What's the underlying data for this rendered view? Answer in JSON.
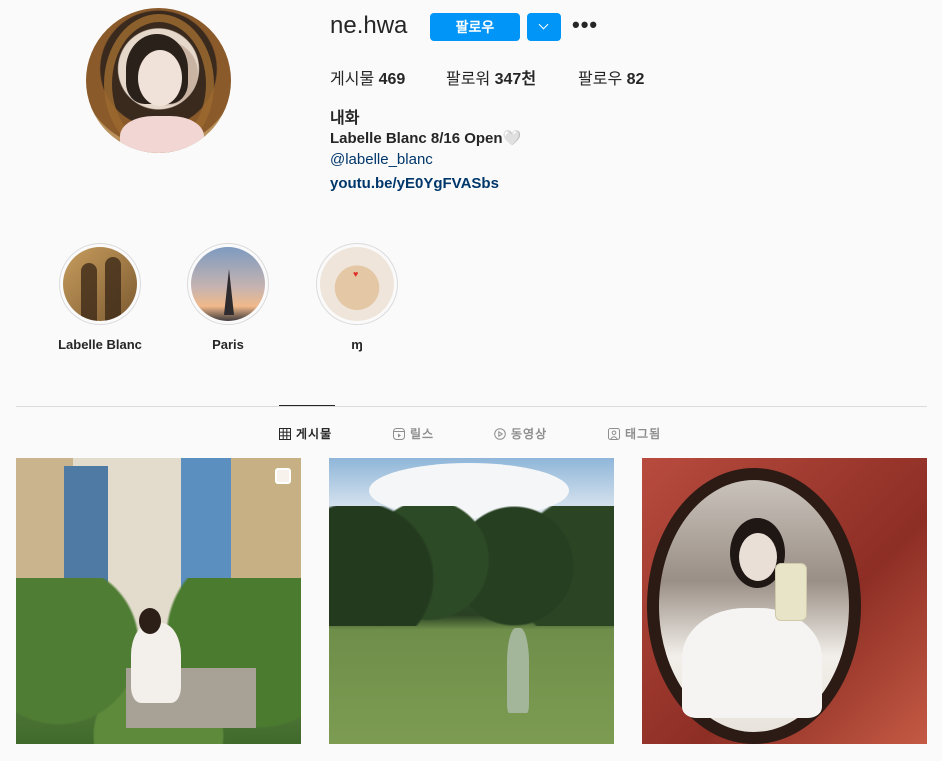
{
  "profile": {
    "username": "ne.hwa",
    "follow_label": "팔로우",
    "more_label": "•••",
    "stats": {
      "posts_label": "게시물",
      "posts_value": "469",
      "followers_label": "팔로워",
      "followers_value": "347천",
      "following_label": "팔로우",
      "following_value": "82"
    },
    "full_name": "내화",
    "bio_line": "Labelle Blanc 8/16 Open🤍",
    "mention": "@labelle_blanc",
    "link": "youtu.be/yE0YgFVASbs"
  },
  "highlights": [
    {
      "label": "Labelle Blanc"
    },
    {
      "label": "Paris"
    },
    {
      "label": "ɱ"
    }
  ],
  "tabs": [
    {
      "label": "게시물",
      "icon": "grid-icon",
      "active": true
    },
    {
      "label": "릴스",
      "icon": "reels-icon",
      "active": false
    },
    {
      "label": "동영상",
      "icon": "video-icon",
      "active": false
    },
    {
      "label": "태그됨",
      "icon": "tagged-icon",
      "active": false
    }
  ],
  "colors": {
    "accent": "#0095f6",
    "link": "#00376b",
    "background": "#fafafa"
  }
}
